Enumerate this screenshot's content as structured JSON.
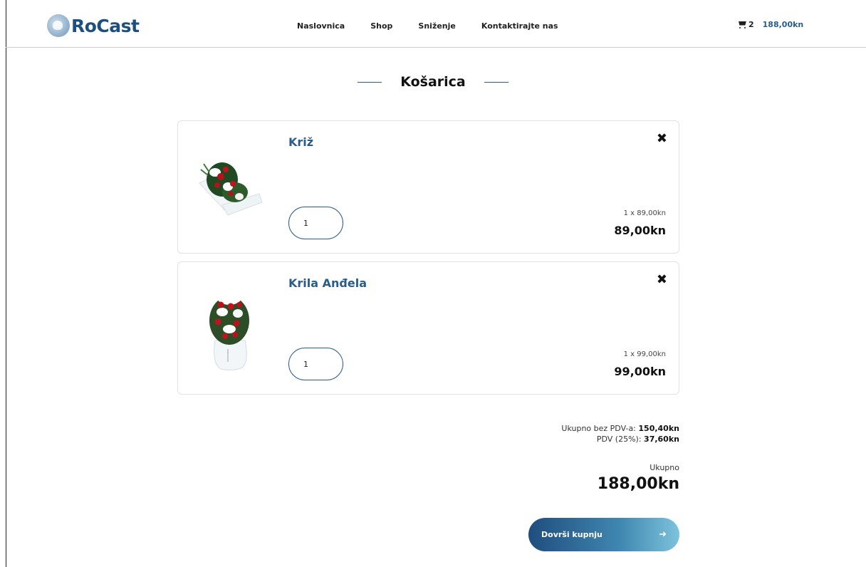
{
  "header": {
    "logo_text": "RoCast",
    "nav": [
      {
        "label": "Naslovnica"
      },
      {
        "label": "Shop"
      },
      {
        "label": "Sniženje"
      },
      {
        "label": "Kontaktirajte nas"
      }
    ],
    "cart": {
      "count": "2",
      "total": "188,00kn",
      "icon": "cart-icon"
    }
  },
  "page": {
    "title": "Košarica"
  },
  "cart_items": [
    {
      "name": "Križ",
      "quantity": "1",
      "unit_line": "1 x 89,00kn",
      "line_total": "89,00kn",
      "remove_icon": "✖"
    },
    {
      "name": "Krila Anđela",
      "quantity": "1",
      "unit_line": "1 x 99,00kn",
      "line_total": "99,00kn",
      "remove_icon": "✖"
    }
  ],
  "summary": {
    "subtotal_label": "Ukupno bez PDV-a:",
    "subtotal_value": "150,40kn",
    "vat_label": "PDV (25%):",
    "vat_value": "37,60kn",
    "total_label": "Ukupno",
    "total_value": "188,00kn"
  },
  "checkout": {
    "label": "Dovrši kupnju",
    "icon": "arrow-right-icon"
  },
  "colors": {
    "brand": "#2a5c8c",
    "logo": "#1d4f80"
  }
}
